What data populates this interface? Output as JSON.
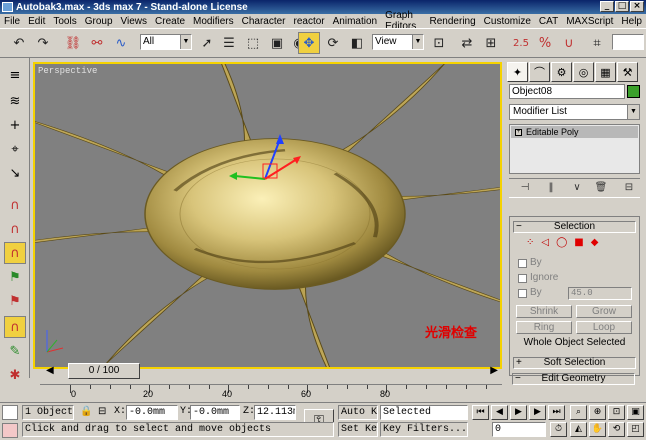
{
  "window": {
    "title": "Autobak3.max - 3ds max 7 - Stand-alone License",
    "btn_min": "_",
    "btn_max": "□",
    "btn_close": "×"
  },
  "menu": [
    "File",
    "Edit",
    "Tools",
    "Group",
    "Views",
    "Create",
    "Modifiers",
    "Character",
    "reactor",
    "Animation",
    "Graph Editors",
    "Rendering",
    "Customize",
    "CAT",
    "MAXScript",
    "Help"
  ],
  "toolbar": {
    "selection_filter": "All",
    "ref_coord": "View",
    "spinner_label": "2.5",
    "percent_label": "%"
  },
  "viewport": {
    "label": "Perspective",
    "annotation": "光滑检查"
  },
  "command_panel": {
    "object_name": "Object08",
    "modifier_list": "Modifier List",
    "stack_item": "Editable Poly",
    "selection_rollout": {
      "title": "Selection",
      "by_vertex": "By",
      "ignore_backfacing": "Ignore",
      "by_angle": "By",
      "angle_value": "45.0",
      "shrink": "Shrink",
      "grow": "Grow",
      "ring": "Ring",
      "loop": "Loop",
      "status": "Whole Object Selected"
    },
    "soft_selection": "Soft Selection",
    "edit_geometry": "Edit Geometry"
  },
  "timeline": {
    "slider": "0 / 100",
    "ruler": [
      "0",
      "20",
      "40",
      "60",
      "80"
    ]
  },
  "status_bar": {
    "selection_count": "1 Object",
    "x_label": "X:",
    "x_value": "-0.0mm",
    "y_label": "Y:",
    "y_value": "-0.0mm",
    "z_label": "Z:",
    "z_value": "12.113mm",
    "auto_key": "Auto Key",
    "set_key": "Set Key",
    "key_mode": "Selected",
    "key_filters": "Key Filters...",
    "prompt": "Click and drag to select and move objects",
    "frame": "0"
  }
}
